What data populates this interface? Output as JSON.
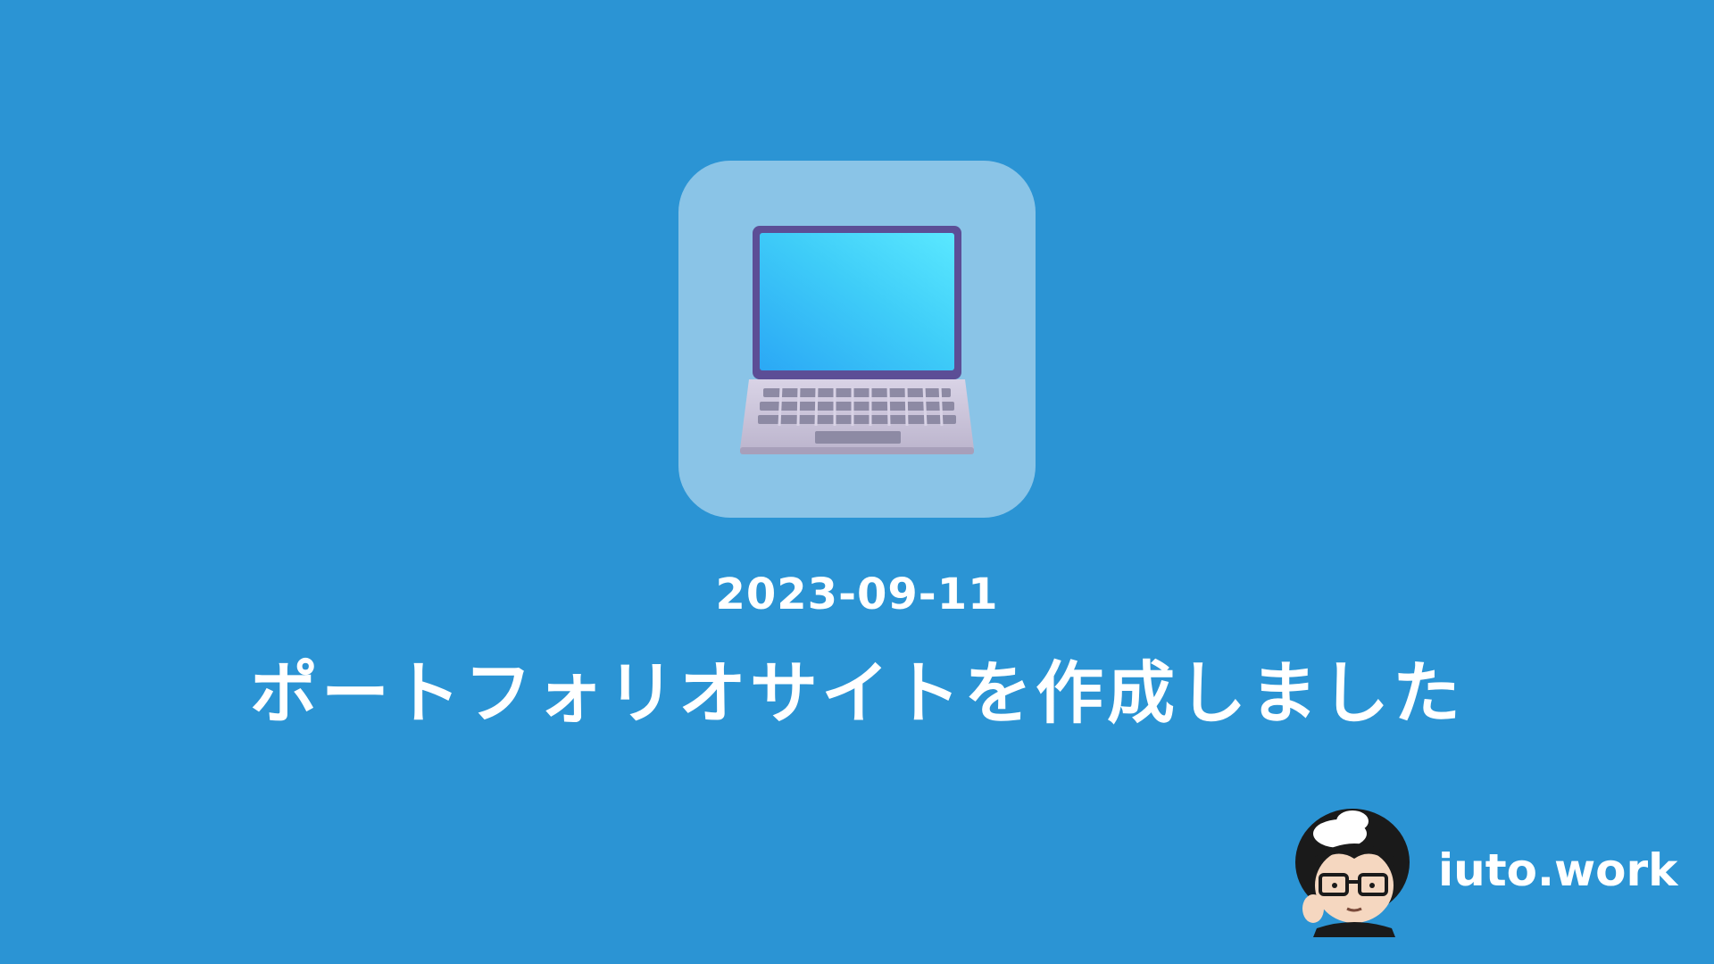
{
  "background_color": "#2B94D4",
  "hero": {
    "icon": "laptop-icon",
    "date": "2023-09-11",
    "title": "ポートフォリオサイトを作成しました"
  },
  "brand": {
    "avatar_icon": "avatar-icon",
    "name": "iuto.work"
  }
}
